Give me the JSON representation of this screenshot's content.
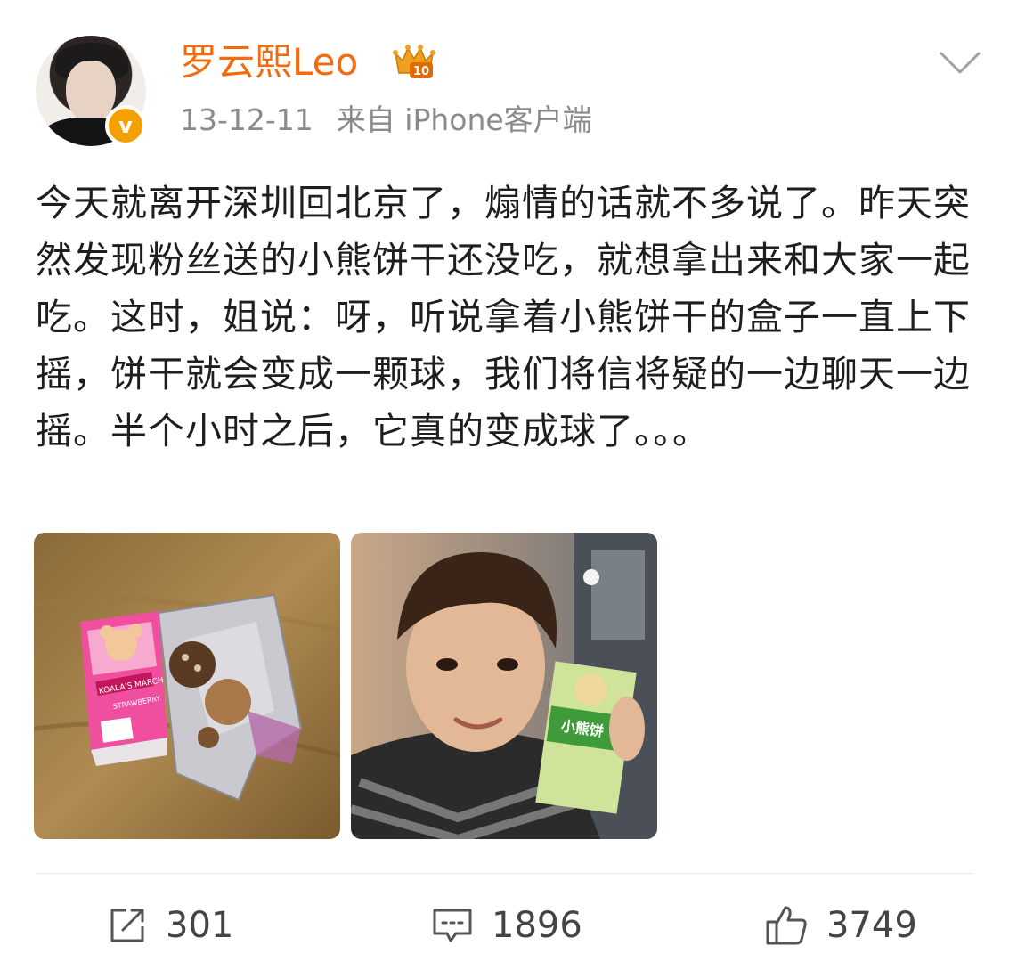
{
  "post": {
    "author": {
      "name": "罗云熙Leo",
      "verified_mark": "v",
      "vip_level": "10"
    },
    "time": "13-12-11",
    "source": "来自 iPhone客户端",
    "text": "今天就离开深圳回北京了，煽情的话就不多说了。昨天突然发现粉丝送的小熊饼干还没吃，就想拿出来和大家一起吃。这时，姐说：呀，听说拿着小熊饼干的盒子一直上下摇，饼干就会变成一颗球，我们将信将疑的一边聊天一边摇。半个小时之后，它真的变成球了。。。",
    "images": [
      {
        "name": "cookie-box-photo",
        "box_brand": "KOALA'S MARCH",
        "box_flavor": "STRAWBERRY"
      },
      {
        "name": "selfie-photo",
        "box_label": "小熊饼"
      }
    ]
  },
  "actions": {
    "repost_count": "301",
    "comment_count": "1896",
    "like_count": "3749"
  },
  "icons": {
    "repost": "share-icon",
    "comment": "comment-icon",
    "like": "thumbs-up-icon",
    "menu": "chevron-down-icon",
    "vip": "crown-badge-icon"
  },
  "colors": {
    "username": "#f26c0f",
    "meta": "#8a8a8a",
    "verified": "#f6a000"
  }
}
